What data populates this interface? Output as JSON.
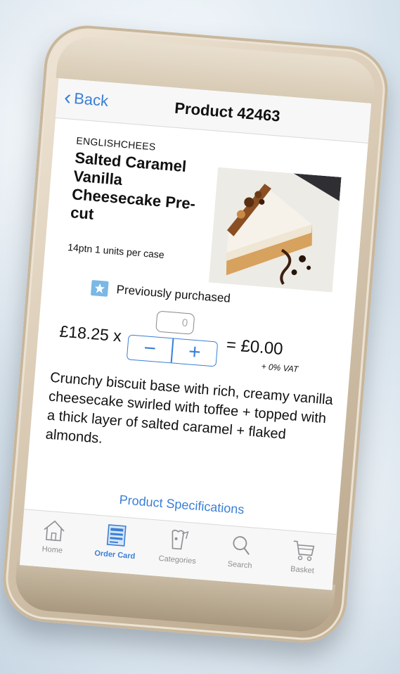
{
  "nav": {
    "back_label": "Back",
    "title": "Product 42463"
  },
  "product": {
    "brand": "ENGLISHCHEES",
    "name": "Salted Caramel Vanilla Cheesecake Pre-cut",
    "pack": "14ptn  1 units per case",
    "previously_purchased": "Previously purchased",
    "price": "£18.25 x",
    "quantity": "0",
    "total": "= £0.00",
    "vat": "+ 0% VAT",
    "description": "Crunchy biscuit base with rich, creamy vanilla cheesecake swirled with toffee + topped with a thick layer of salted caramel + flaked almonds.",
    "spec_link": "Product Specifications"
  },
  "stepper": {
    "minus": "−",
    "plus": "+"
  },
  "tabs": [
    {
      "label": "Home",
      "icon": "home-icon",
      "active": false
    },
    {
      "label": "Order Card",
      "icon": "order-card-icon",
      "active": true
    },
    {
      "label": "Categories",
      "icon": "categories-icon",
      "active": false
    },
    {
      "label": "Search",
      "icon": "search-icon",
      "active": false
    },
    {
      "label": "Basket",
      "icon": "basket-icon",
      "active": false
    }
  ],
  "colors": {
    "accent": "#3a7fd5",
    "star_badge": "#7ab8e6",
    "phone_frame": "#d9cab4"
  }
}
